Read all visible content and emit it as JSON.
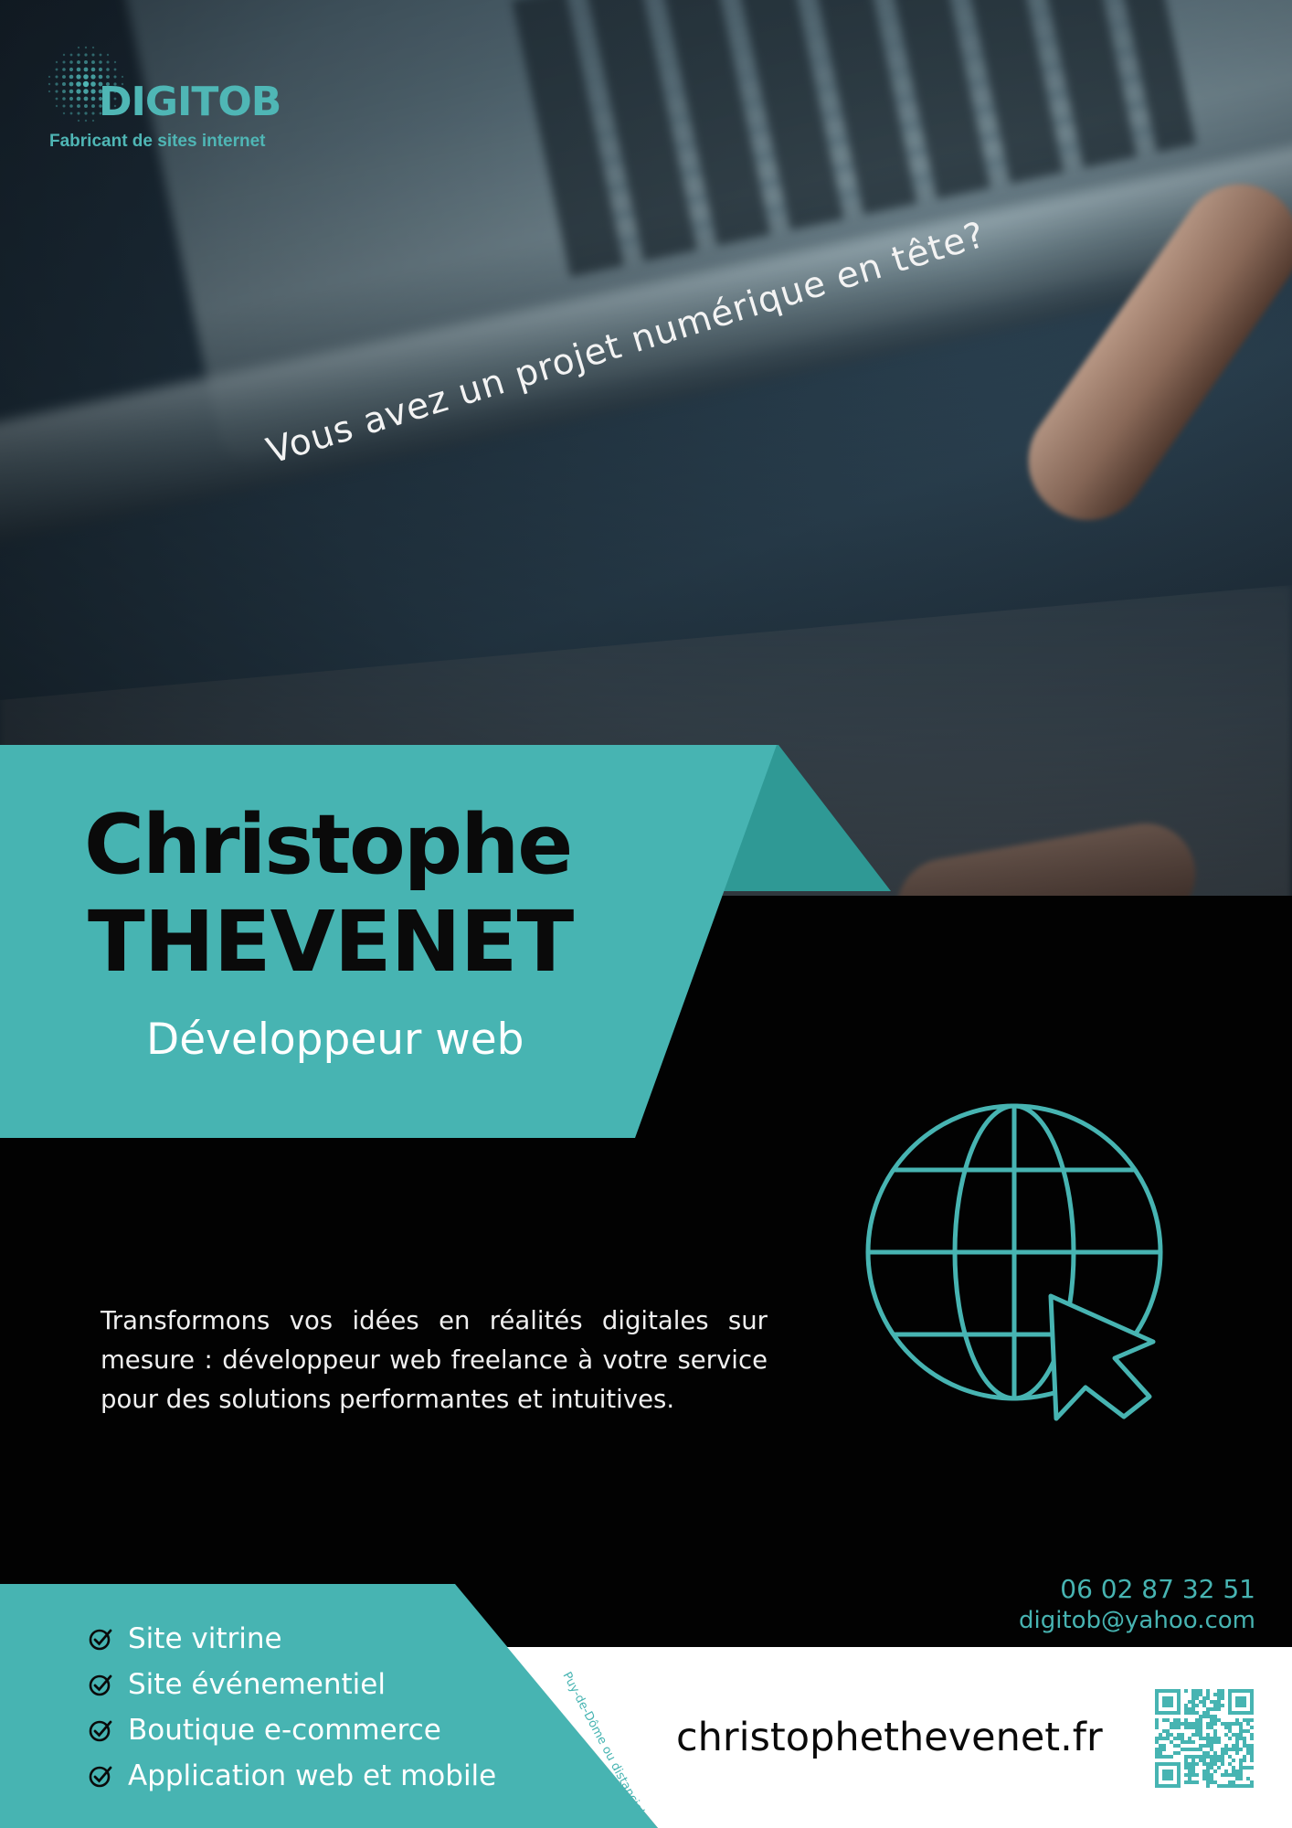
{
  "brand": {
    "name": "DIGITOB",
    "tagline": "Fabricant de sites internet",
    "accent_color": "#47b4b2",
    "logo_icon": "dotted-globe-logo"
  },
  "headline": "Vous avez un projet numérique en tête?",
  "person": {
    "first_name": "Christophe",
    "last_name": "THEVENET",
    "role": "Développeur web"
  },
  "pitch": "Transformons vos idées en réalités digitales sur mesure : développeur web freelance à votre service pour des solutions performantes et intuitives.",
  "services": [
    {
      "label": "Site vitrine",
      "icon": "check-circle-icon"
    },
    {
      "label": "Site événementiel",
      "icon": "check-circle-icon"
    },
    {
      "label": "Boutique e-commerce",
      "icon": "check-circle-icon"
    },
    {
      "label": "Application web et mobile",
      "icon": "check-circle-icon"
    }
  ],
  "contact": {
    "phone": "06 02 87 32 51",
    "email": "digitob@yahoo.com",
    "location": "Puy-de-Dôme ou distanciel",
    "website": "christophethevenet.fr"
  },
  "icons": {
    "main_illustration": "globe-cursor-icon",
    "qr": "qr-code"
  }
}
